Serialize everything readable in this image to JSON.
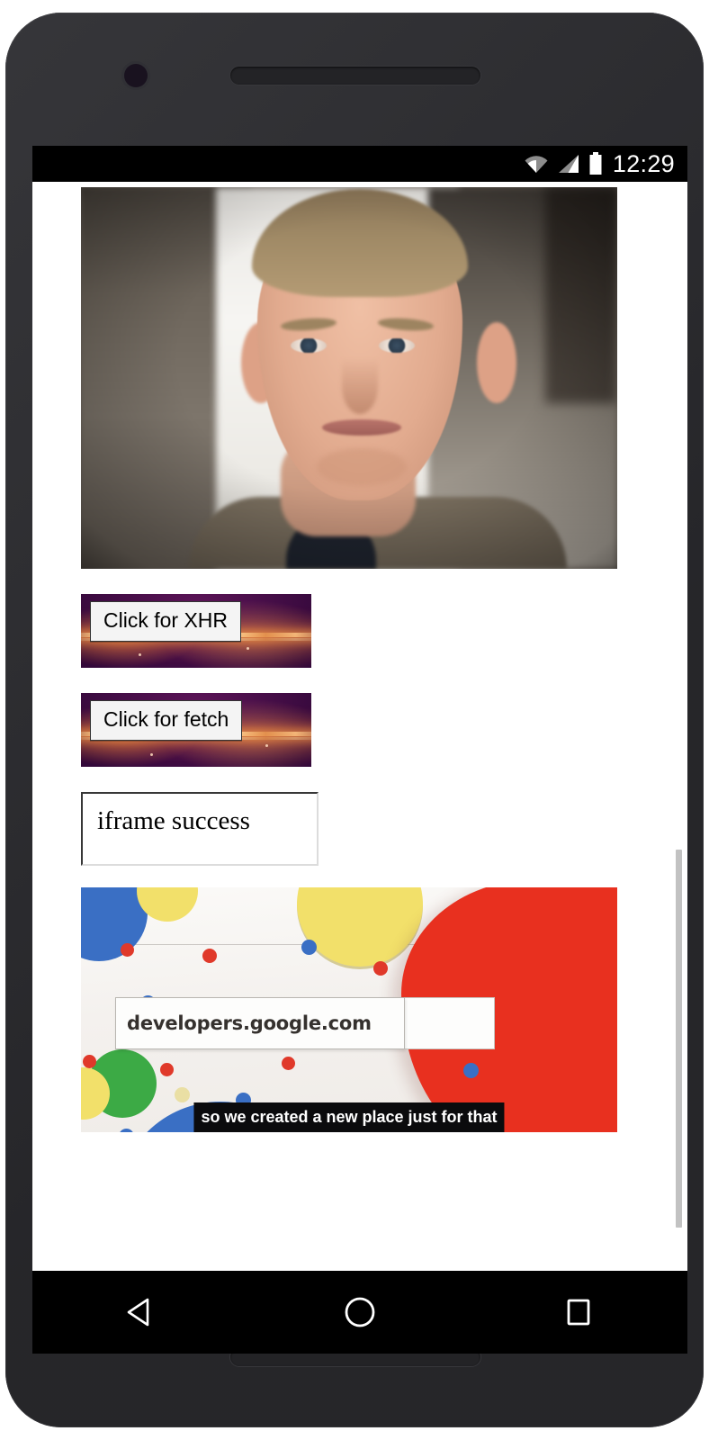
{
  "device": {
    "type": "android-phone",
    "hardware": {
      "front_camera": "front-camera",
      "earpiece": "earpiece-speaker",
      "bottom_speaker": "bottom-speaker"
    }
  },
  "status_bar": {
    "clock": "12:29",
    "icons": [
      "wifi-icon",
      "cellular-signal-icon",
      "battery-icon"
    ],
    "background": "#000000",
    "foreground": "#ffffff"
  },
  "page": {
    "background": "#ffffff",
    "portrait": {
      "alt": "portrait-photo",
      "description": "Close-up portrait of a smiling man with short blond hair"
    },
    "buttons": [
      {
        "label": "Click for XHR",
        "name": "click-for-xhr-button",
        "banner": "purple-nebula-banner"
      },
      {
        "label": "Click for fetch",
        "name": "click-for-fetch-button",
        "banner": "purple-nebula-banner"
      }
    ],
    "iframe": {
      "text": "iframe success",
      "name": "success-iframe"
    },
    "video": {
      "url_text": "developers.google.com",
      "caption": "so we created a new place just for that",
      "colors": {
        "red": "#e8301f",
        "blue": "#3a6fc4",
        "yellow": "#f2e06a",
        "green": "#3caa45",
        "paper": "#f7f5f3"
      }
    },
    "scrollbar": {
      "name": "page-scrollbar",
      "color": "#c2c2c2"
    }
  },
  "nav_bar": {
    "background": "#000000",
    "buttons": [
      {
        "name": "nav-back-button",
        "icon": "back-triangle-icon"
      },
      {
        "name": "nav-home-button",
        "icon": "home-circle-icon"
      },
      {
        "name": "nav-recents-button",
        "icon": "recents-square-icon"
      }
    ]
  }
}
